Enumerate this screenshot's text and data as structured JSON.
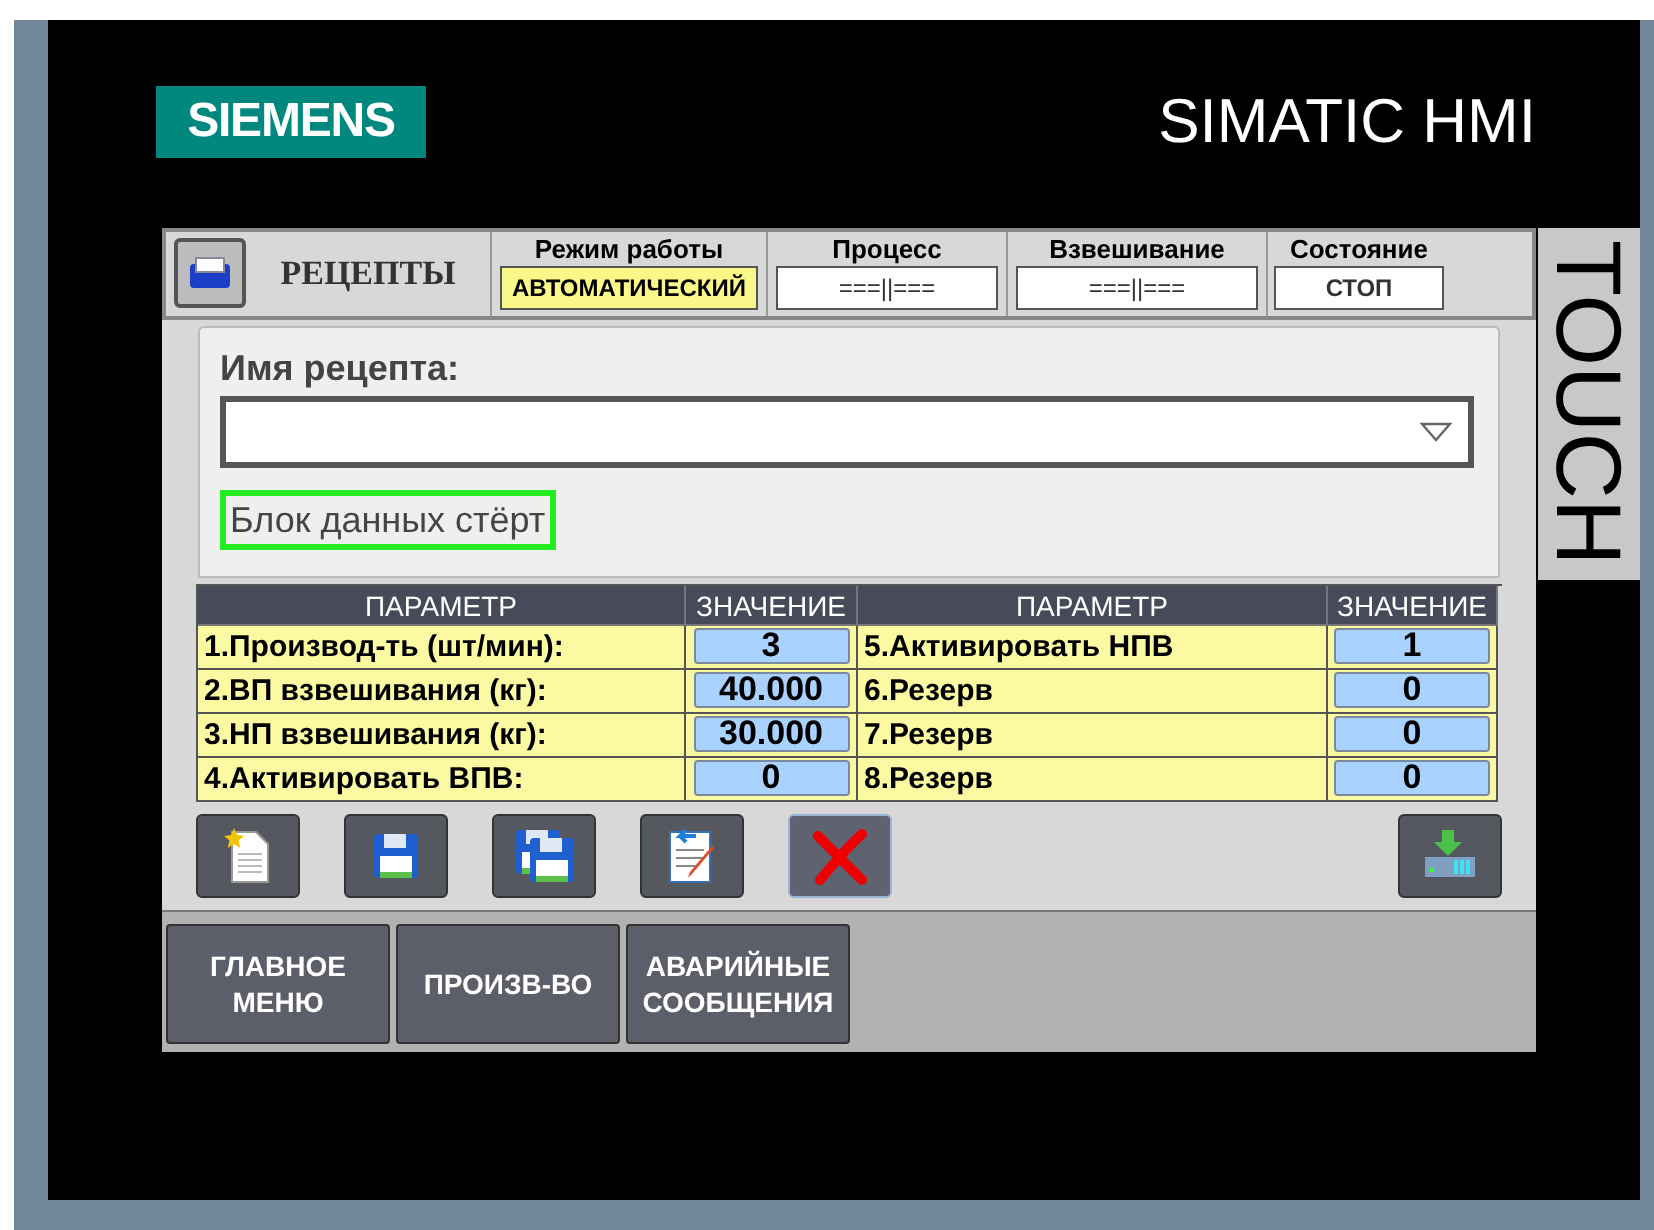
{
  "brand": {
    "logo": "SIEMENS",
    "product": "SIMATIC HMI",
    "side_label": "TOUCH"
  },
  "header": {
    "title": "РЕЦЕПТЫ",
    "statuses": [
      {
        "label": "Режим работы",
        "value": "АВТОМАТИЧЕСКИЙ",
        "highlighted": true
      },
      {
        "label": "Процесс",
        "value": "===||===",
        "highlighted": false
      },
      {
        "label": "Взвешивание",
        "value": "===||===",
        "highlighted": false
      },
      {
        "label": "Состояние",
        "value": "СТОП",
        "highlighted": false
      }
    ]
  },
  "recipe": {
    "label": "Имя рецепта:",
    "message": "Блок данных стёрт"
  },
  "table": {
    "columns": [
      "ПАРАМЕТР",
      "ЗНАЧЕНИЕ",
      "ПАРАМЕТР",
      "ЗНАЧЕНИЕ"
    ],
    "rows": [
      {
        "left": {
          "param": "1.Производ-ть (шт/мин):",
          "value": "3"
        },
        "right": {
          "param": "5.Активировать НПВ",
          "value": "1"
        }
      },
      {
        "left": {
          "param": "2.ВП взвешивания (кг):",
          "value": "40.000"
        },
        "right": {
          "param": "6.Резерв",
          "value": "0"
        }
      },
      {
        "left": {
          "param": "3.НП взвешивания (кг):",
          "value": "30.000"
        },
        "right": {
          "param": "7.Резерв",
          "value": "0"
        }
      },
      {
        "left": {
          "param": "4.Активировать ВПВ:",
          "value": "0"
        },
        "right": {
          "param": "8.Резерв",
          "value": "0"
        }
      }
    ]
  },
  "toolbar": [
    {
      "kind": "new",
      "selected": false
    },
    {
      "kind": "save",
      "selected": false
    },
    {
      "kind": "save_as",
      "selected": false
    },
    {
      "kind": "rename",
      "selected": false
    },
    {
      "kind": "delete",
      "selected": true
    },
    {
      "kind": "load",
      "selected": false
    }
  ],
  "nav": [
    {
      "label": "ГЛАВНОЕ МЕНЮ"
    },
    {
      "label": "ПРОИЗВ-ВО"
    },
    {
      "label": "АВАРИЙНЫЕ СООБЩЕНИЯ"
    }
  ]
}
